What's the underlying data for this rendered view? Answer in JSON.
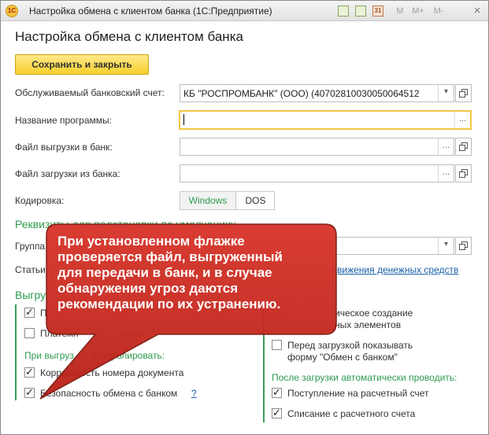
{
  "titlebar": {
    "logo": "1С",
    "title": "Настройка обмена с клиентом банка  (1С:Предприятие)",
    "btn_m": "M",
    "btn_mplus": "M+",
    "btn_mminus": "M-",
    "btn_calendar": "31",
    "btn_close": "×"
  },
  "form": {
    "title": "Настройка обмена с клиентом банка",
    "save_close": "Сохранить и закрыть"
  },
  "fields": {
    "account_label": "Обслуживаемый банковский счет:",
    "account_value": "КБ \"РОСПРОМБАНК\" (ООО) (40702810030050064512",
    "program_label": "Название программы:",
    "program_value": "",
    "export_label": "Файл выгрузки в банк:",
    "export_value": "",
    "import_label": "Файл загрузки из банка:",
    "import_value": "",
    "encoding_label": "Кодировка:",
    "encoding_windows": "Windows",
    "encoding_dos": "DOS",
    "ellipsis": "...",
    "dropdown": "▾"
  },
  "defaults": {
    "section": "Реквизиты для подстановки по умолчанию:",
    "group_label": "Группа",
    "articles_label": "Статьи",
    "articles_link": "движения денежных средств"
  },
  "upload": {
    "section": "Выгру",
    "cb1_label": "П",
    "cb2_label": "Платежн",
    "cb2_tail": "ание",
    "control_label": "При выгруз",
    "control_tail": "контролировать:",
    "cb3_label": "Корректность номера документа",
    "cb4_label": "Безопасность обмена с банком",
    "help": "?"
  },
  "load": {
    "cb1_label_line1": "ическое создание",
    "cb1_label_line2": "ных элементов",
    "cb2_label_line1": "Перед загрузкой показывать",
    "cb2_label_line2": "форму \"Обмен с банком\"",
    "auto_label": "После загрузки автоматически проводить:",
    "cb3_label": "Поступление на расчетный счет",
    "cb4_label": "Списание с расчетного счета"
  },
  "callout": {
    "line1": "При установленном флажке",
    "line2": "проверяется файл, выгруженный",
    "line3": "для передачи в банк, и в случае",
    "line4": "обнаружения угроз даются",
    "line5": "рекомендации по их устранению."
  },
  "colors": {
    "accent_green": "#2e9b4e",
    "callout_red": "#c8281e",
    "save_yellow": "#f7cf2c",
    "link_blue": "#1a5fa8"
  }
}
